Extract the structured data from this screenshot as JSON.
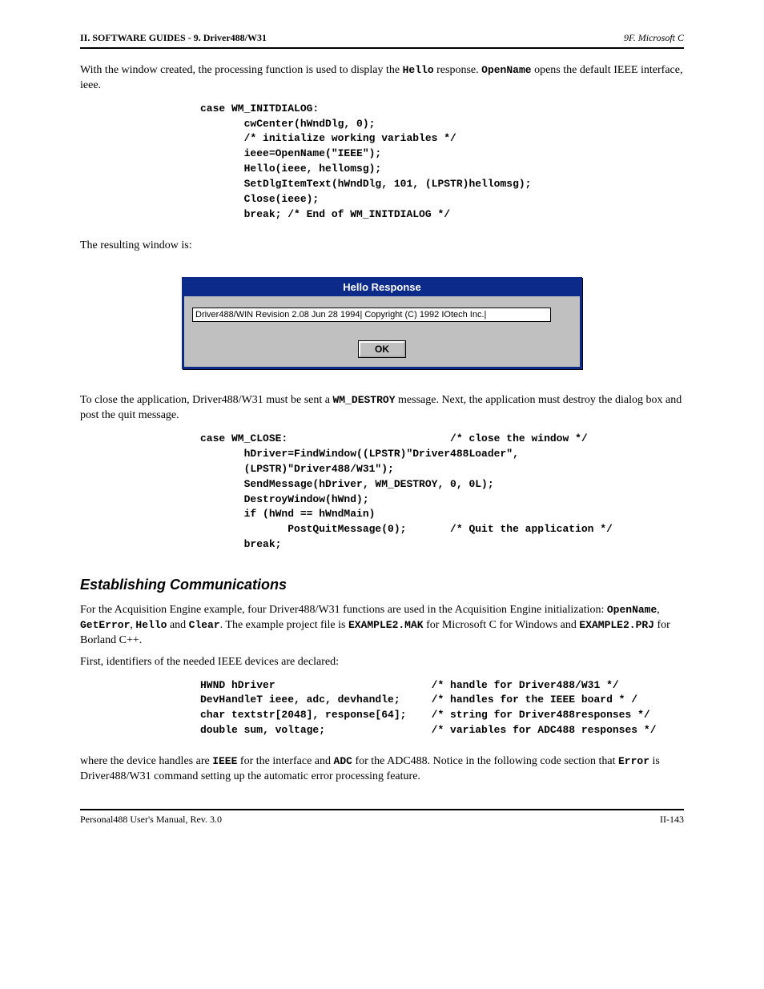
{
  "header": {
    "left": "II. SOFTWARE GUIDES - 9. Driver488/W31",
    "right": "9F. Microsoft C"
  },
  "para1_pre": "With the window created, the processing function is used to display the ",
  "para1_mono1": "Hello",
  "para1_mid": " response. ",
  "para1_mono2": "OpenName",
  "para1_post": " opens the default IEEE interface, ieee.",
  "code1": "case WM_INITDIALOG:\n       cwCenter(hWndDlg, 0);\n       /* initialize working variables */\n       ieee=OpenName(\"IEEE\");\n       Hello(ieee, hellomsg);\n       SetDlgItemText(hWndDlg, 101, (LPSTR)hellomsg);\n       Close(ieee);\n       break; /* End of WM_INITDIALOG */",
  "para2": "The resulting window is:",
  "dialog": {
    "title": "Hello Response",
    "field": "Driver488/WIN Revision 2.08 Jun 28 1994| Copyright (C) 1992 IOtech Inc.|",
    "ok": "OK"
  },
  "para3_pre": "To close the application, Driver488/W31 must be sent a ",
  "para3_mono": "WM_DESTROY",
  "para3_post": " message. Next, the application must destroy the dialog box and post the quit message.",
  "code2": "case WM_CLOSE:                          /* close the window */\n       hDriver=FindWindow((LPSTR)\"Driver488Loader\",\n       (LPSTR)\"Driver488/W31\");\n       SendMessage(hDriver, WM_DESTROY, 0, 0L);\n       DestroyWindow(hWnd);\n       if (hWnd == hWndMain)\n              PostQuitMessage(0);       /* Quit the application */\n       break;",
  "section": "Establishing Communications",
  "para4_a": "For the Acquisition Engine example, four Driver488/W31 functions are used in the Acquisition Engine initialization: ",
  "para4_m1": "OpenName",
  "para4_b": ", ",
  "para4_m2": "GetError",
  "para4_c": ", ",
  "para4_m3": "Hello",
  "para4_d": " and ",
  "para4_m4": "Clear",
  "para4_e": ". The example project file is ",
  "para4_m5": "EXAMPLE2.MAK",
  "para4_f": " for Microsoft C for Windows and ",
  "para4_m6": "EXAMPLE2.PRJ",
  "para4_g": " for Borland C++.",
  "para5": "First, identifiers of the needed IEEE devices are declared:",
  "code3": "HWND hDriver                         /* handle for Driver488/W31 */\nDevHandleT ieee, adc, devhandle;     /* handles for the IEEE board * /\nchar textstr[2048], response[64];    /* string for Driver488responses */\ndouble sum, voltage;                 /* variables for ADC488 responses */",
  "para6_a": "where the device handles are ",
  "para6_m1": "IEEE",
  "para6_b": " for the interface and ",
  "para6_m2": "ADC",
  "para6_c": " for the ADC488. Notice in the following code section that ",
  "para6_m3": "Error",
  "para6_d": " is Driver488/W31 command setting up the automatic error processing feature.",
  "footer": {
    "left": "Personal488 User's Manual, Rev. 3.0",
    "right": "II-143"
  }
}
